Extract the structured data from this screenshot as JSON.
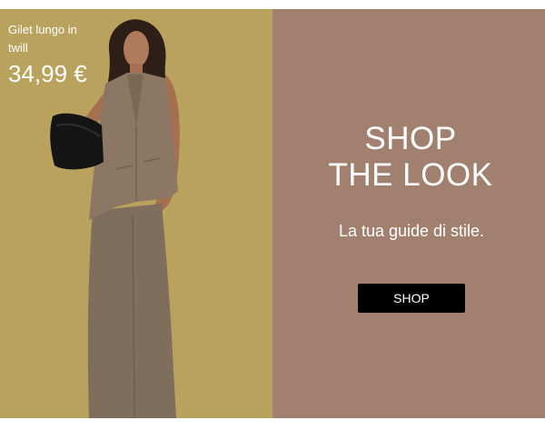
{
  "product": {
    "name": "Gilet lungo in twill",
    "price": "34,99 €"
  },
  "promo": {
    "headline_line1": "SHOP",
    "headline_line2": "THE LOOK",
    "tagline": "La tua guide di stile.",
    "button_label": "SHOP"
  },
  "colors": {
    "photo_background": "#b9a25e",
    "promo_background": "#a2806f",
    "button_background": "#000000",
    "text": "#ffffff"
  }
}
